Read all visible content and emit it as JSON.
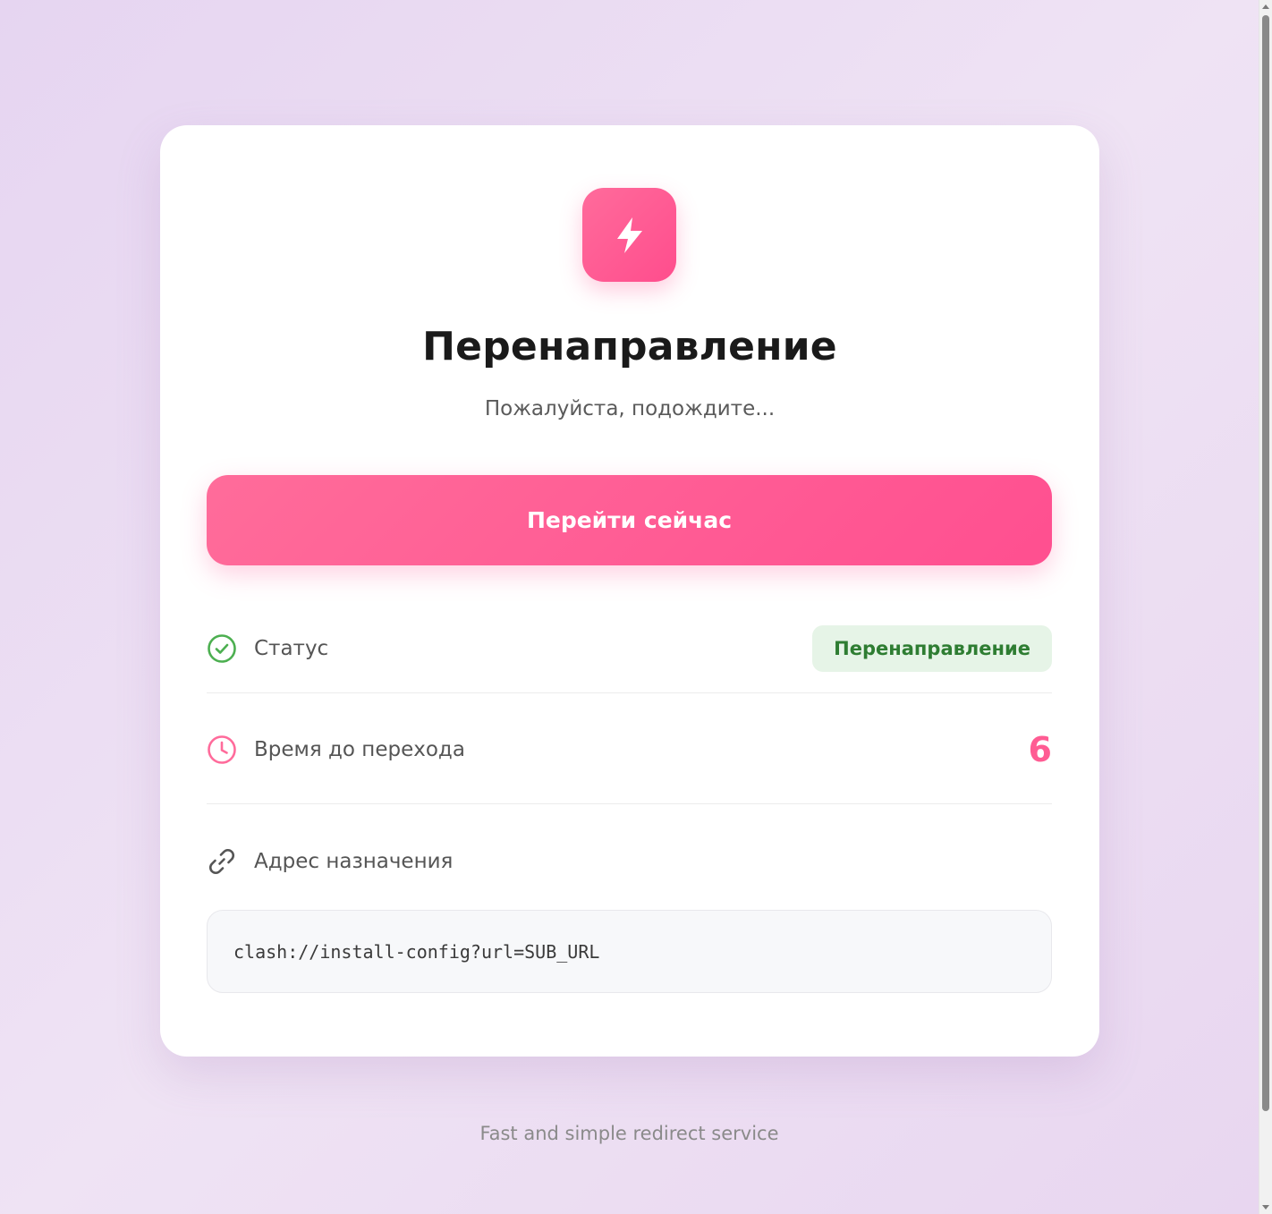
{
  "page": {
    "title": "Перенаправление",
    "subtitle": "Пожалуйста, подождите...",
    "logo_icon": "lightning-bolt-icon"
  },
  "actions": {
    "go_now_label": "Перейти сейчас"
  },
  "details": {
    "status": {
      "icon": "check-circle-icon",
      "label": "Статус",
      "value": "Перенаправление"
    },
    "time": {
      "icon": "clock-icon",
      "label": "Время до перехода",
      "value": "6"
    },
    "address": {
      "icon": "link-icon",
      "label": "Адрес назначения",
      "value": "clash://install-config?url=SUB_URL"
    }
  },
  "footer": {
    "text": "Fast and simple redirect service"
  },
  "colors": {
    "accent": "#ff5c93",
    "success": "#2e7d32",
    "success_bg": "#e6f4e7",
    "background": "#eadcf2"
  }
}
